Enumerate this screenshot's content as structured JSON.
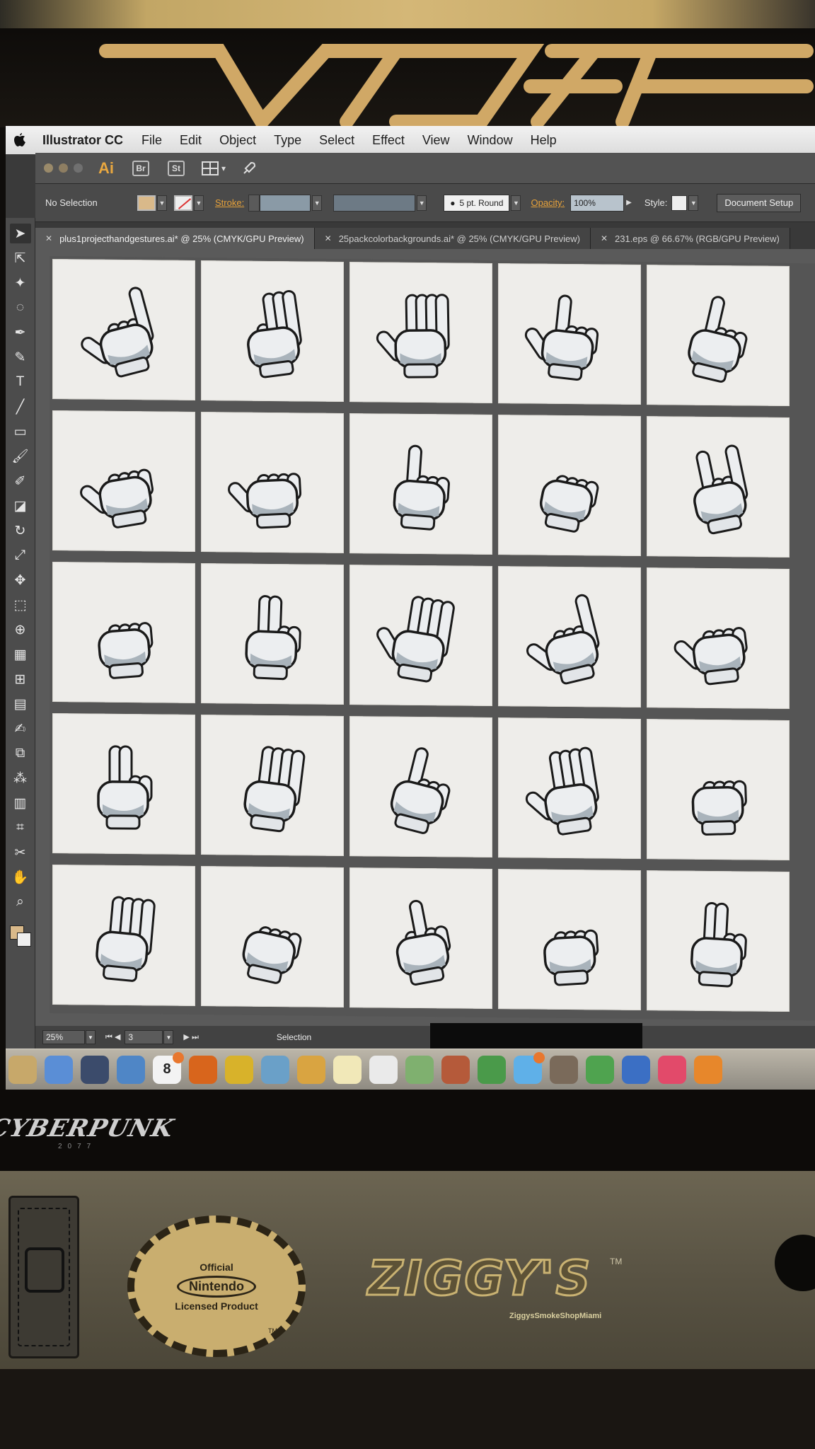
{
  "menubar": {
    "app_name": "Illustrator CC",
    "items": [
      "File",
      "Edit",
      "Object",
      "Type",
      "Select",
      "Effect",
      "View",
      "Window",
      "Help"
    ]
  },
  "titlebar": {
    "app_badge": "Ai",
    "bridge_label": "Br",
    "stock_label": "St"
  },
  "control_bar": {
    "selection_status": "No Selection",
    "stroke_label": "Stroke:",
    "brush_label": "5 pt. Round",
    "opacity_label": "Opacity:",
    "opacity_value": "100%",
    "style_label": "Style:",
    "document_setup_label": "Document Setup",
    "fill_color": "#d9b98a"
  },
  "tabs": [
    {
      "label": "plus1projecthandgestures.ai* @ 25% (CMYK/GPU Preview)",
      "active": true
    },
    {
      "label": "25packcolorbackgrounds.ai* @ 25% (CMYK/GPU Preview)",
      "active": false
    },
    {
      "label": "231.eps @ 66.67% (RGB/GPU Preview)",
      "active": false
    }
  ],
  "tools": [
    "selection-tool",
    "direct-selection-tool",
    "magic-wand-tool",
    "lasso-tool",
    "pen-tool",
    "curvature-tool",
    "type-tool",
    "line-segment-tool",
    "rectangle-tool",
    "paintbrush-tool",
    "shaper-tool",
    "eraser-tool",
    "rotate-tool",
    "scale-tool",
    "puppet-warp-tool",
    "free-transform-tool",
    "shape-builder-tool",
    "perspective-grid-tool",
    "mesh-tool",
    "gradient-tool",
    "eyedropper-tool",
    "blend-tool",
    "symbol-sprayer-tool",
    "column-graph-tool",
    "artboard-tool",
    "slice-tool",
    "hand-tool",
    "zoom-tool"
  ],
  "artboard": {
    "gestures": [
      "L-sign",
      "OK-sign",
      "open-palm",
      "handshake",
      "pointing-up",
      "thumbs-up-side",
      "thumbs-up",
      "index-finger-up",
      "fist",
      "rock-on",
      "fist-front",
      "pointing-sideways",
      "raised-hand",
      "call-me",
      "thumbs-up-motion",
      "peace-sign",
      "counting-four",
      "index-up-back",
      "open-palm-up",
      "knocking-fist",
      "pat-hand",
      "punch-motion",
      "middle-finger",
      "bump-fist",
      "peace-sign-back"
    ]
  },
  "statusbar": {
    "zoom": "25%",
    "page": "3",
    "current_tool": "Selection"
  },
  "dock": {
    "apps": [
      "preview",
      "finder",
      "launchpad",
      "safari",
      "calendar",
      "firefox",
      "chrome",
      "photos",
      "notes",
      "stickies",
      "reminders",
      "maps",
      "bugs",
      "facetime",
      "messages",
      "keynote",
      "numbers",
      "keynote-presenter",
      "itunes",
      "ibooks"
    ],
    "calendar_day": "8"
  },
  "environment": {
    "cyberpunk_text": "CYBERPUNK",
    "cyberpunk_year": "2077",
    "nintendo_official": "Official",
    "nintendo_brand": "Nintendo",
    "nintendo_licensed": "Licensed Product",
    "nintendo_tm": "TM",
    "ziggys_logo": "ZIGGY'S",
    "ziggys_tm": "TM",
    "ziggys_sub": "ZiggysSmokeShopMiami"
  }
}
